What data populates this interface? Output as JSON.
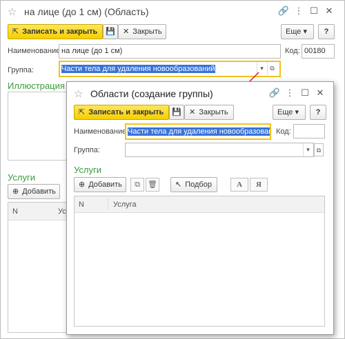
{
  "back": {
    "title": "на лице (до 1 см) (Область)",
    "save_close": "Записать и закрыть",
    "close": "Закрыть",
    "more": "Еще",
    "help": "?",
    "name_label": "Наименование:",
    "name_value": "на лице (до 1 см)",
    "code_label": "Код:",
    "code_value": "00180",
    "group_label": "Группа:",
    "group_value": "Части тела для удаления новообразований",
    "illustration": "Иллюстрация",
    "services": "Услуги",
    "add": "Добавить",
    "col_n": "N",
    "col_service": "Услу"
  },
  "front": {
    "title": "Области (создание группы)",
    "save_close": "Записать и закрыть",
    "close": "Закрыть",
    "more": "Еще",
    "help": "?",
    "name_label": "Наименование:",
    "name_value": "Части тела для удаления новообразований",
    "code_label": "Код:",
    "code_value": "",
    "group_label": "Группа:",
    "group_value": "",
    "services": "Услуги",
    "add": "Добавить",
    "pick": "Подбор",
    "font_a": "А",
    "font_ya": "Я",
    "col_n": "N",
    "col_service": "Услуга"
  },
  "colors": {
    "accent_yellow": "#f5cf00",
    "section_green": "#3a9a3a",
    "selection_blue": "#3873d8",
    "arrow_red": "#e02020"
  }
}
